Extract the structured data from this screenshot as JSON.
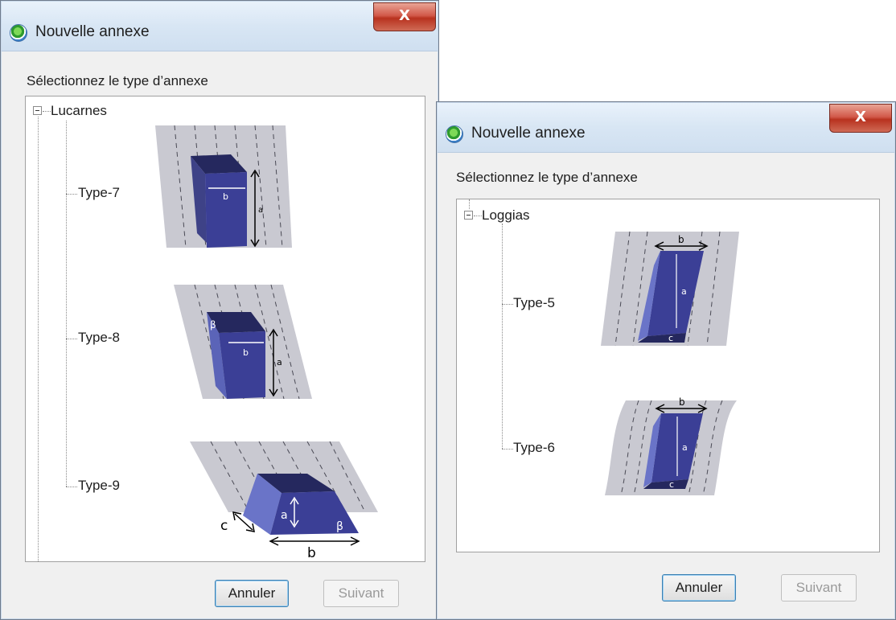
{
  "dialog_left": {
    "title": "Nouvelle annexe",
    "close_label": "X",
    "prompt": "Sélectionnez le type d’annexe",
    "tree": {
      "root_label": "Lucarnes",
      "items": [
        {
          "label": "Type-7",
          "dims": [
            "b",
            "a"
          ]
        },
        {
          "label": "Type-8",
          "dims": [
            "β",
            "b",
            "a"
          ]
        },
        {
          "label": "Type-9",
          "dims": [
            "a",
            "β",
            "c",
            "b"
          ]
        }
      ]
    },
    "buttons": {
      "cancel": "Annuler",
      "next": "Suivant"
    }
  },
  "dialog_right": {
    "title": "Nouvelle annexe",
    "close_label": "X",
    "prompt": "Sélectionnez le type d’annexe",
    "tree": {
      "root_label": "Loggias",
      "items": [
        {
          "label": "Type-5",
          "dims": [
            "b",
            "a",
            "c"
          ]
        },
        {
          "label": "Type-6",
          "dims": [
            "b",
            "a",
            "c"
          ]
        }
      ]
    },
    "buttons": {
      "cancel": "Annuler",
      "next": "Suivant"
    }
  },
  "colors": {
    "titlebar": "#d8e6f4",
    "close": "#c7483a",
    "shape": "#3a3d94",
    "roof": "#c9c9d1"
  }
}
